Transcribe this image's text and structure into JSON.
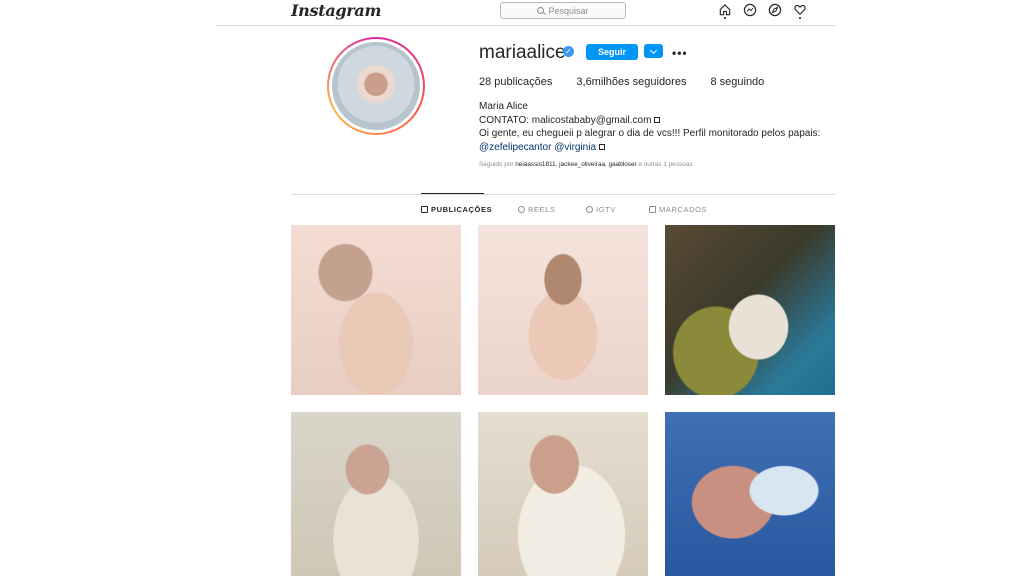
{
  "topbar": {
    "logo": "Instagram",
    "search_placeholder": "Pesquisar",
    "icons": [
      "home-icon",
      "messenger-icon",
      "explore-icon",
      "heart-icon"
    ]
  },
  "profile": {
    "username": "mariaalice",
    "verified": true,
    "follow_label": "Seguir",
    "more_label": "•••",
    "stats": {
      "posts": "28 publicações",
      "followers": "3,6milhões seguidores",
      "following": "8 seguindo"
    },
    "bio": {
      "name": "Maria Alice",
      "contact": "CONTATO: malicostababy@gmail.com",
      "text": "Oi gente, eu chegueii p alegrar o dia de vcs!!! Perfil monitorado pelos papais:",
      "mentions": "@zefelipecantor @virginia"
    },
    "followed_by": {
      "prefix": "Seguido por",
      "users": "neiaassis1811, jackee_oliveiraa, gaabloser",
      "suffix": "e outras 1 pessoas"
    }
  },
  "tabs": [
    {
      "label": "PUBLICAÇÕES",
      "icon": "grid-icon",
      "active": true
    },
    {
      "label": "REELS",
      "icon": "reels-icon",
      "active": false
    },
    {
      "label": "IGTV",
      "icon": "igtv-icon",
      "active": false
    },
    {
      "label": "MARCADOS",
      "icon": "tagged-icon",
      "active": false
    }
  ],
  "colors": {
    "accent": "#0095f6",
    "text": "#262626",
    "muted": "#8e8e8e",
    "link": "#00376b"
  }
}
